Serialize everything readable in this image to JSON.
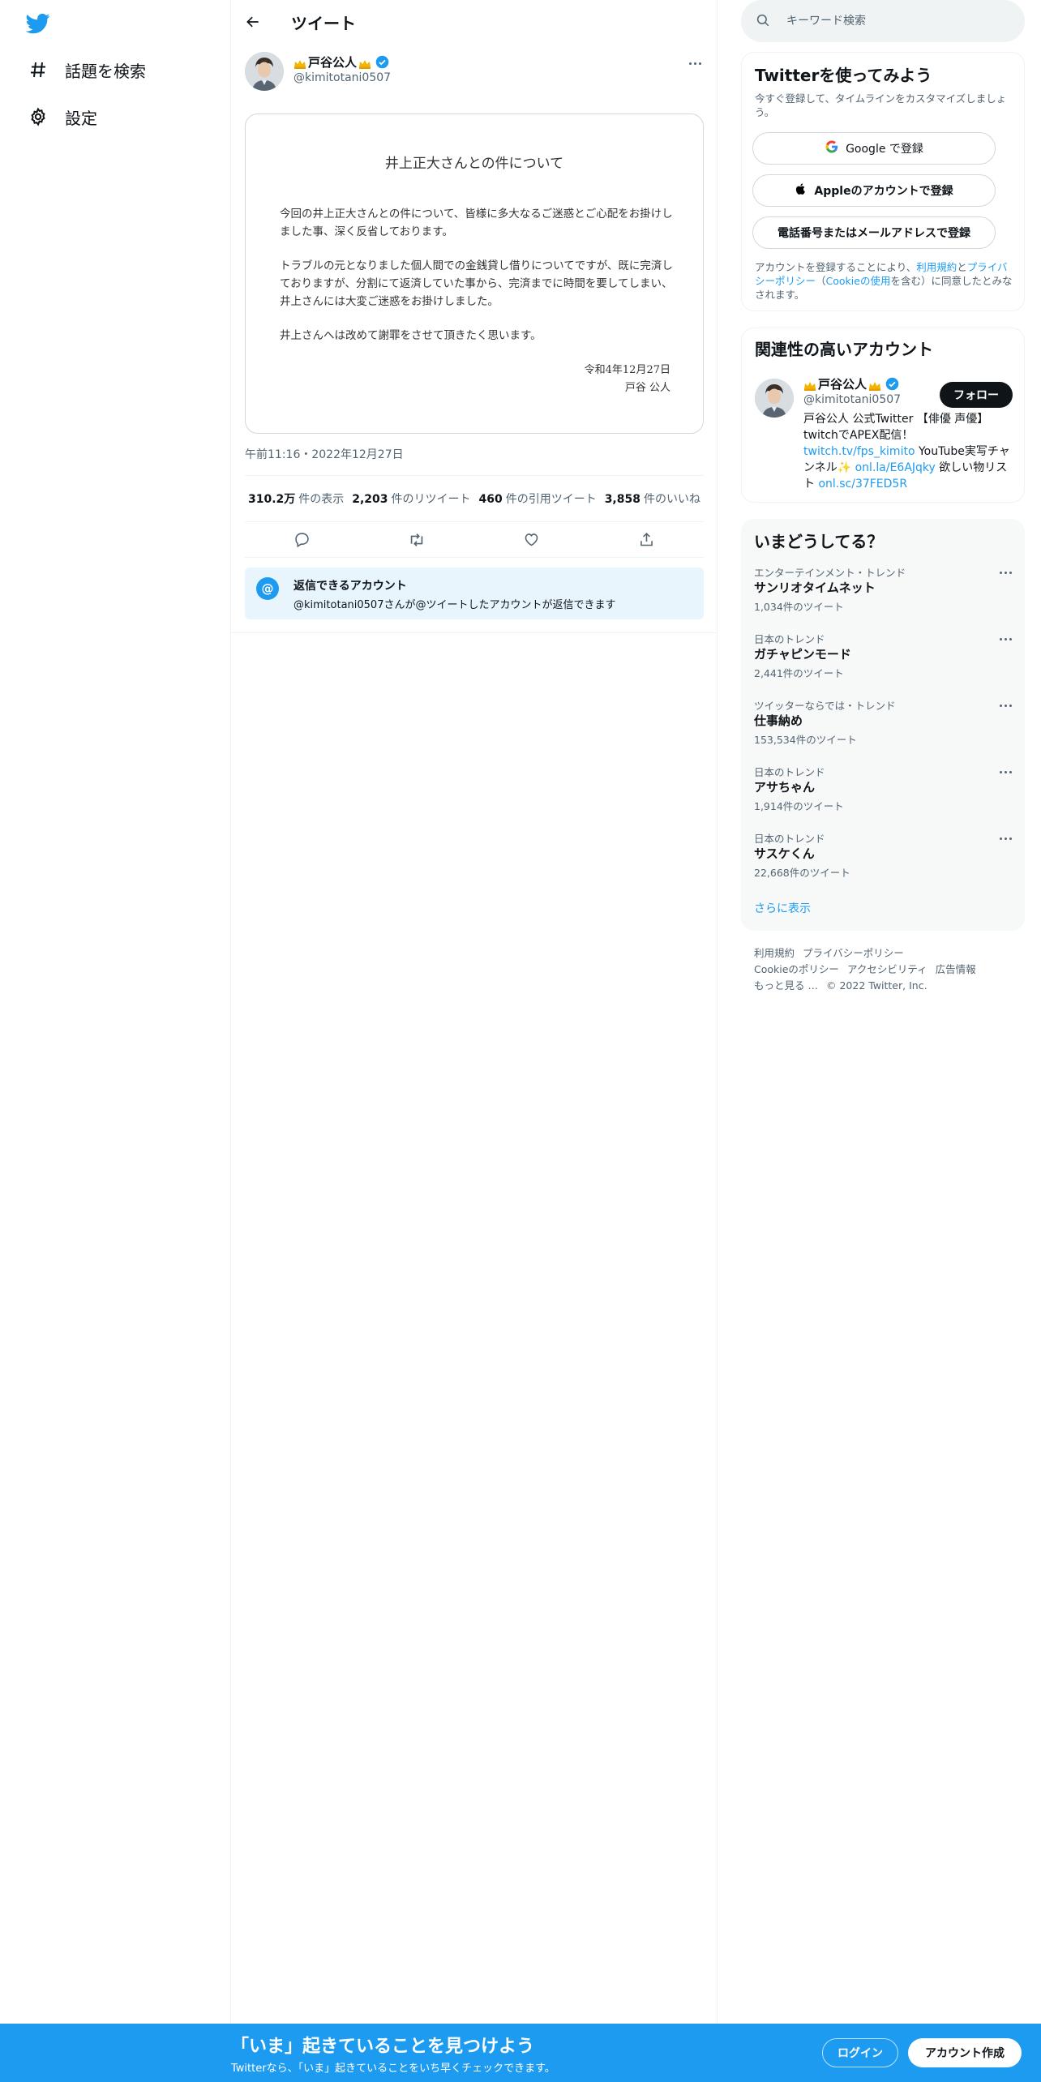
{
  "nav": {
    "explore_label": "話題を検索",
    "settings_label": "設定"
  },
  "header": {
    "title": "ツイート"
  },
  "tweet": {
    "author_name": "戸谷公人",
    "author_handle": "@kimitotani0507",
    "notice": {
      "title": "井上正大さんとの件について",
      "paragraph1": "今回の井上正大さんとの件について、皆様に多大なるご迷惑とご心配をお掛けしました事、深く反省しております。",
      "paragraph2": "トラブルの元となりました個人間での金銭貸し借りについてですが、既に完済しておりますが、分割にて返済していた事から、完済までに時間を要してしまい、井上さんには大変ご迷惑をお掛けしました。",
      "paragraph3": "井上さんへは改めて謝罪をさせて頂きたく思います。",
      "date": "令和4年12月27日",
      "signature": "戸谷 公人"
    },
    "timestamp": "午前11:16・2022年12月27日",
    "stats": {
      "views_count": "310.2万",
      "views_label": "件の表示",
      "retweets_count": "2,203",
      "retweets_label": "件のリツイート",
      "quotes_count": "460",
      "quotes_label": "件の引用ツイート",
      "likes_count": "3,858",
      "likes_label": "件のいいね"
    },
    "reply_restriction": {
      "title": "返信できるアカウント",
      "description": "@kimitotani0507さんが@ツイートしたアカウントが返信できます"
    }
  },
  "search": {
    "placeholder": "キーワード検索"
  },
  "signup": {
    "title": "Twitterを使ってみよう",
    "subtitle": "今すぐ登録して、タイムラインをカスタマイズしましょう。",
    "google_button": "Google で登録",
    "apple_button": "Appleのアカウントで登録",
    "phone_button": "電話番号またはメールアドレスで登録",
    "legal_prefix": "アカウントを登録することにより、",
    "legal_terms": "利用規約",
    "legal_and": "と",
    "legal_privacy": "プライバシーポリシー",
    "legal_cookie_open": "（",
    "legal_cookie": "Cookieの使用",
    "legal_suffix": "を含む）に同意したとみなされます。"
  },
  "related": {
    "title": "関連性の高いアカウント",
    "name": "戸谷公人",
    "handle": "@kimitotani0507",
    "follow_button": "フォロー",
    "bio_part1": "戸谷公人 公式Twitter 【俳優 声優】twitchでAPEX配信！",
    "bio_link1": "twitch.tv/fps_kimito",
    "bio_part2": " YouTube実写チャンネル✨ ",
    "bio_link2": "onl.la/E6AJqky",
    "bio_part3": " 欲しい物リスト ",
    "bio_link3": "onl.sc/37FED5R"
  },
  "trends": {
    "title": "いまどうしてる？",
    "items": [
      {
        "category": "エンターテインメント・トレンド",
        "name": "サンリオタイムネット",
        "count": "1,034件のツイート"
      },
      {
        "category": "日本のトレンド",
        "name": "ガチャピンモード",
        "count": "2,441件のツイート"
      },
      {
        "category": "ツイッターならでは・トレンド",
        "name": "仕事納め",
        "count": "153,534件のツイート"
      },
      {
        "category": "日本のトレンド",
        "name": "アサちゃん",
        "count": "1,914件のツイート"
      },
      {
        "category": "日本のトレンド",
        "name": "サスケくん",
        "count": "22,668件のツイート"
      }
    ],
    "show_more": "さらに表示"
  },
  "footer": {
    "terms": "利用規約",
    "privacy": "プライバシーポリシー",
    "cookie": "Cookieのポリシー",
    "accessibility": "アクセシビリティ",
    "ads": "広告情報",
    "more": "もっと見る …",
    "copyright": "© 2022 Twitter, Inc."
  },
  "bottom_bar": {
    "title": "「いま」起きていることを見つけよう",
    "subtitle": "Twitterなら、「いま」起きていることをいち早くチェックできます。",
    "login_button": "ログイン",
    "signup_button": "アカウント作成"
  },
  "colors": {
    "brand": "#1d9bf0",
    "text": "#0f1419",
    "secondary": "#536471"
  }
}
